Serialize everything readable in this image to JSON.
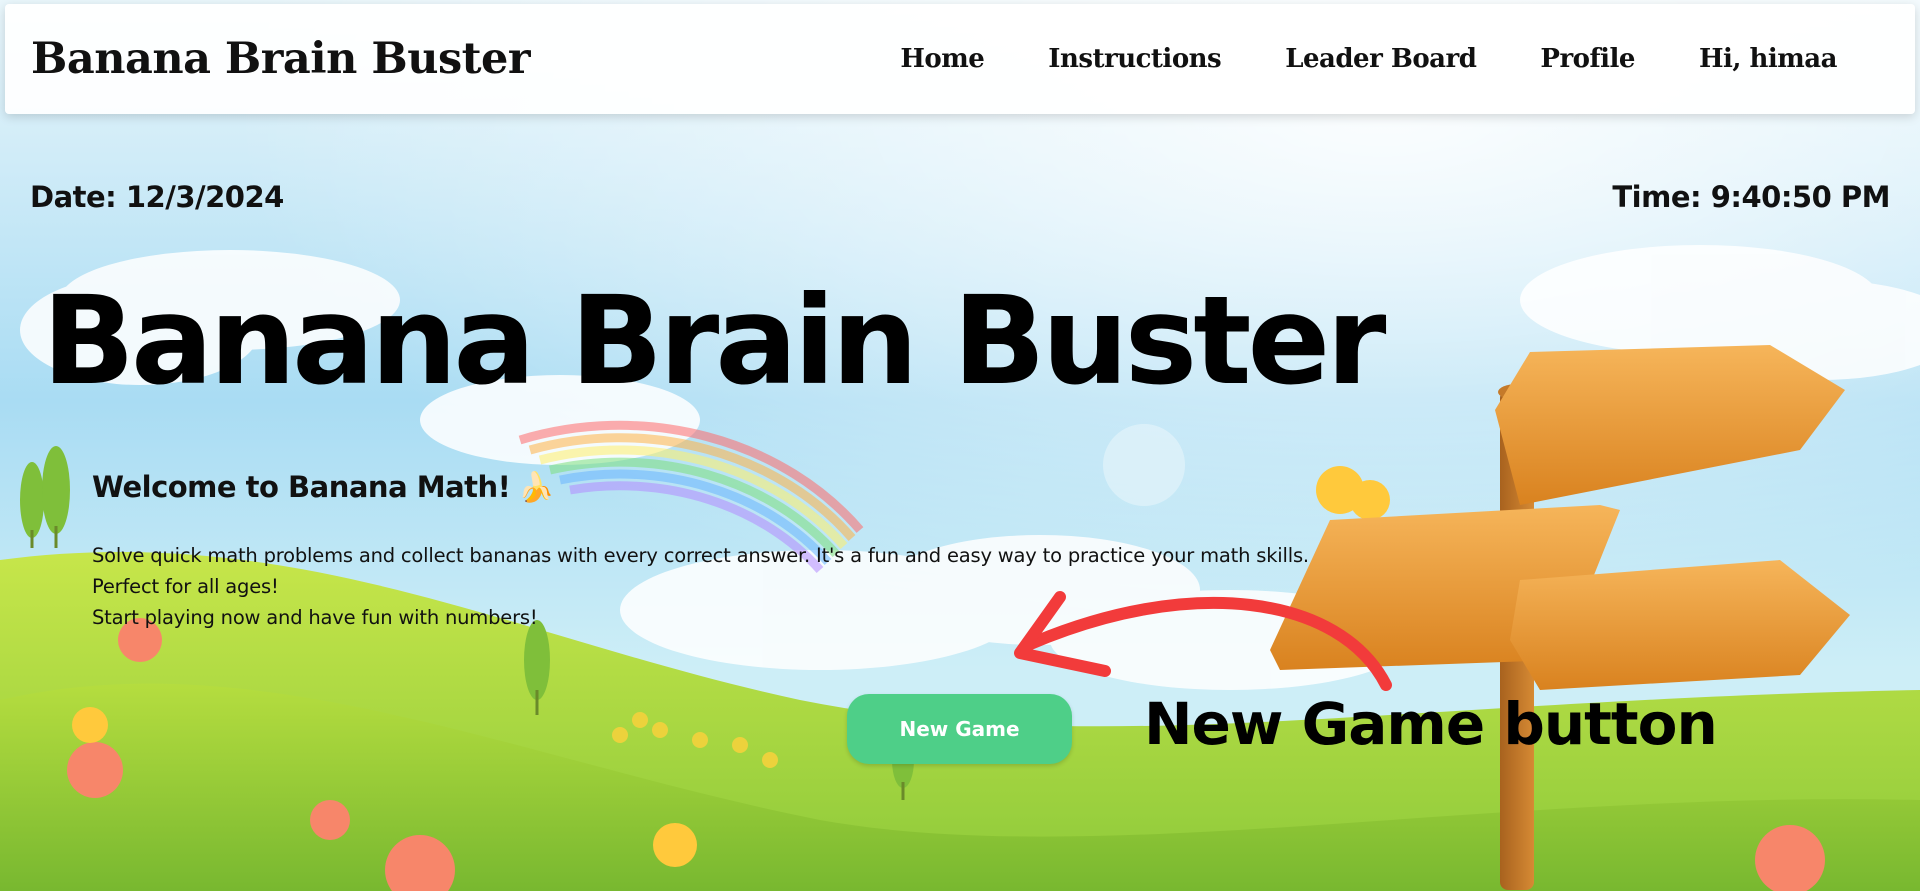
{
  "header": {
    "brand": "Banana Brain Buster",
    "nav": [
      {
        "label": "Home"
      },
      {
        "label": "Instructions"
      },
      {
        "label": "Leader Board"
      },
      {
        "label": "Profile"
      },
      {
        "label": "Hi, himaa"
      }
    ]
  },
  "status": {
    "date": "Date: 12/3/2024",
    "time": "Time: 9:40:50 PM"
  },
  "hero": {
    "title": "Banana Brain Buster",
    "welcome": "Welcome to Banana Math!",
    "welcome_emoji": "🍌",
    "description_lines": [
      "Solve quick math problems and collect bananas with every correct answer. It's a fun and easy way to practice your math skills.",
      "Perfect for all ages!",
      "Start playing now and have fun with numbers!"
    ],
    "new_game_label": "New Game"
  },
  "annotation": {
    "label": "New Game button",
    "arrow_color": "#f23b3b"
  },
  "colors": {
    "button": "#4ecf88",
    "sky": "#7fc8ef",
    "grass": "#9ed43c",
    "sign": "#e8932c"
  }
}
